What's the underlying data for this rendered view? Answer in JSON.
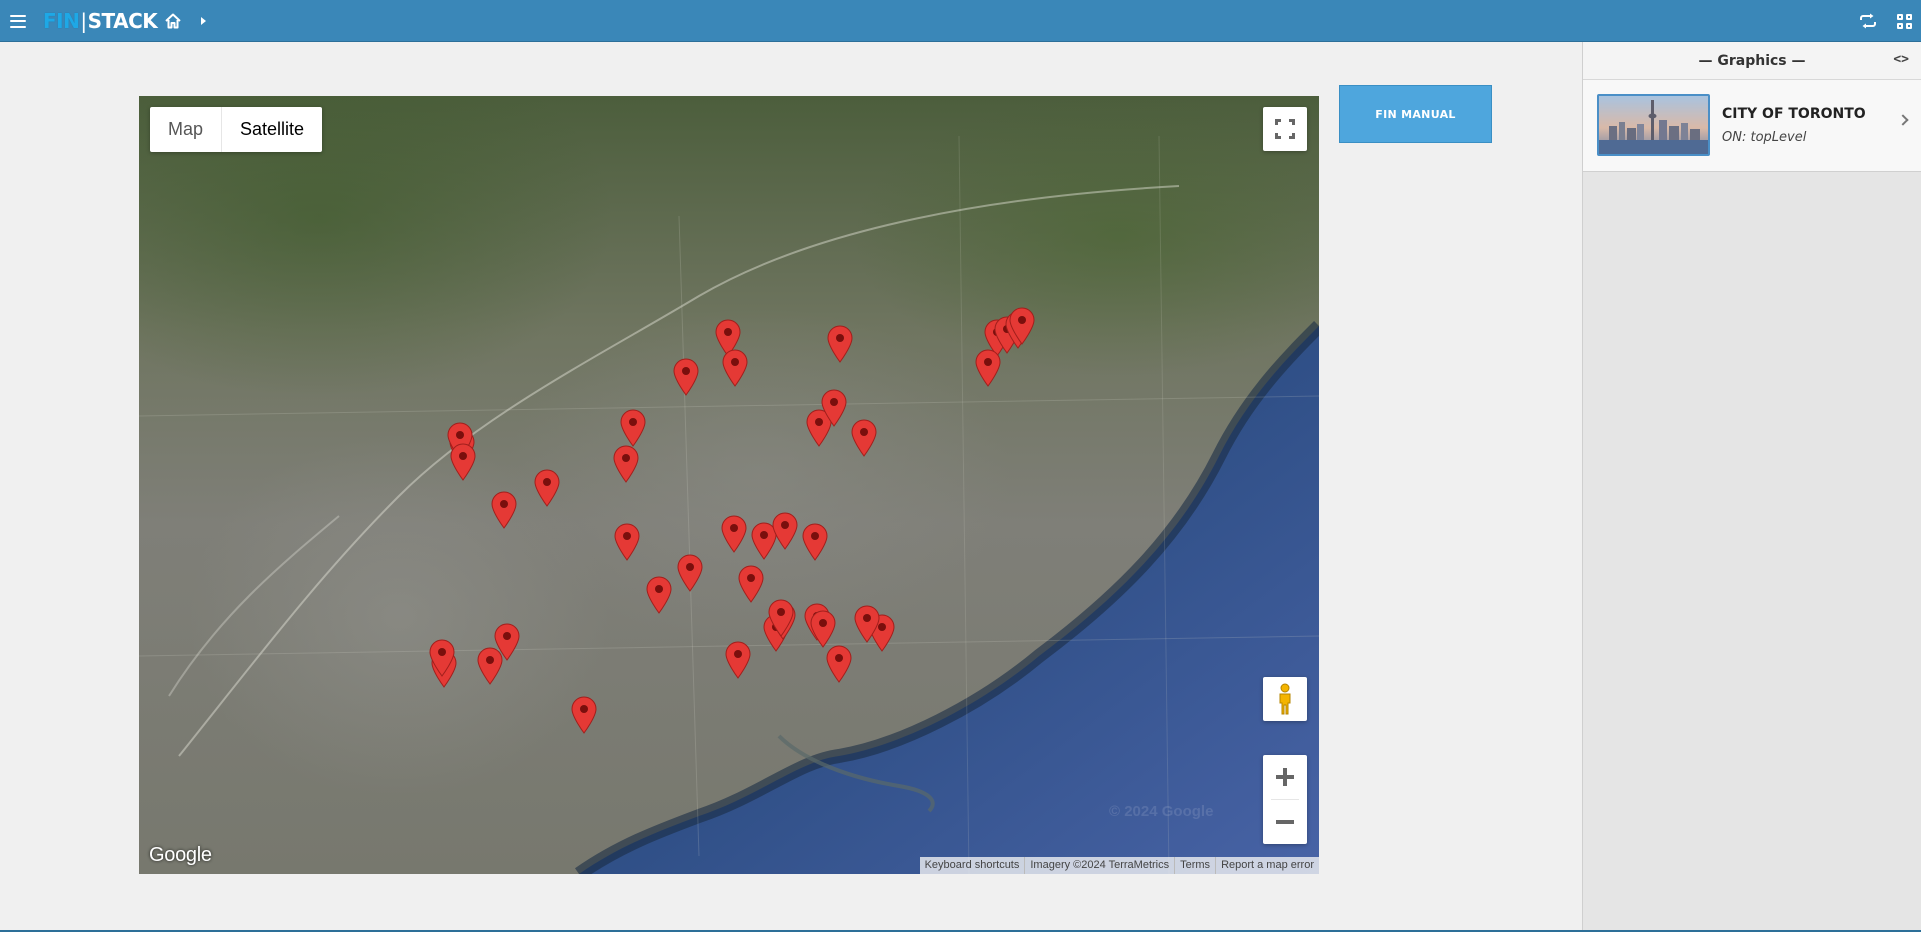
{
  "app": {
    "logo_left": "FIN",
    "logo_right": "STACK"
  },
  "icons": {
    "menu": "hamburger-icon",
    "home": "home-icon",
    "breadcrumb": "caret-right-icon",
    "refresh": "refresh-icon",
    "apps": "apps-grid-icon"
  },
  "map": {
    "type_options": [
      "Map",
      "Satellite"
    ],
    "selected_type": "Satellite",
    "google_logo": "Google",
    "watermark": "© 2024 Google",
    "attribution": [
      "Keyboard shortcuts",
      "Imagery ©2024 TerraMetrics",
      "Terms",
      "Report a map error"
    ],
    "marker_color": "#e53935",
    "marker_count": 41
  },
  "manual_button": {
    "label": "FIN MANUAL"
  },
  "panel": {
    "title": "— Graphics —",
    "items": [
      {
        "title": "CITY OF TORONTO",
        "subtitle": "ON: topLevel"
      }
    ]
  },
  "colors": {
    "topbar": "#3a87b8",
    "accent": "#4ea6dd",
    "marker": "#e53935"
  }
}
